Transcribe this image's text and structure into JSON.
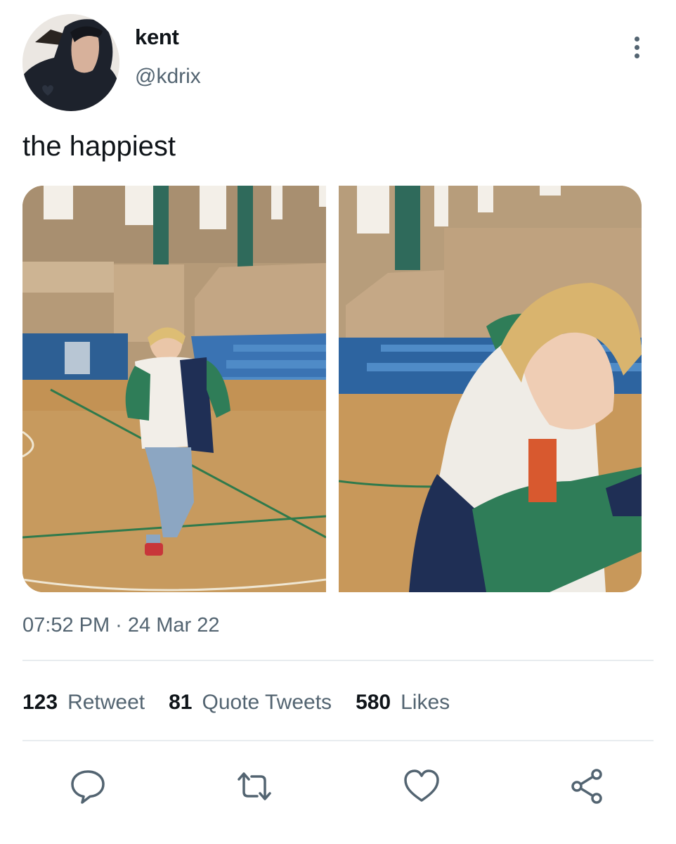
{
  "author": {
    "display_name": "kent",
    "handle": "@kdrix"
  },
  "tweet": {
    "text": "the happiest",
    "timestamp": "07:52 PM · 24 Mar 22"
  },
  "media": [
    {
      "description": "person running in gym"
    },
    {
      "description": "close-up of person running"
    }
  ],
  "stats": [
    {
      "count": "123",
      "label": "Retweet"
    },
    {
      "count": "81",
      "label": "Quote Tweets"
    },
    {
      "count": "580",
      "label": "Likes"
    }
  ],
  "actions": {
    "reply_icon": "reply-icon",
    "retweet_icon": "retweet-icon",
    "like_icon": "heart-icon",
    "share_icon": "share-icon"
  },
  "colors": {
    "primary_text": "#0f1419",
    "secondary_text": "#536471",
    "divider": "#e8ecef"
  }
}
